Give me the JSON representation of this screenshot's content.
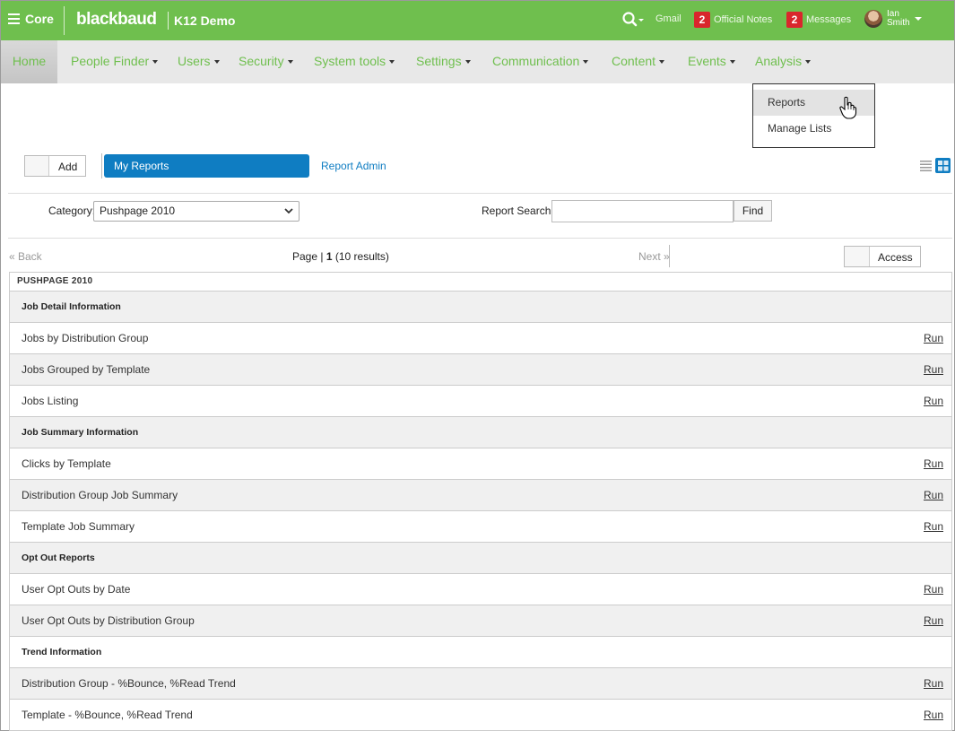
{
  "topbar": {
    "menu_label": "Core",
    "brand": "blackbaud",
    "brand_sub": "K12 Demo",
    "gmail": "Gmail",
    "official_notes": {
      "count": "2",
      "label": "Official Notes"
    },
    "messages": {
      "count": "2",
      "label": "Messages"
    },
    "user": {
      "first": "Ian",
      "last": "Smith"
    },
    "colors": {
      "bar": "#6fbf4e",
      "badge": "#d9262c"
    }
  },
  "nav": {
    "home": "Home",
    "items": [
      "People Finder",
      "Users",
      "Security",
      "System tools",
      "Settings",
      "Communication",
      "Content",
      "Events",
      "Analysis"
    ]
  },
  "analysis_menu": {
    "items": [
      "Reports",
      "Manage Lists"
    ]
  },
  "toolbar": {
    "add_label": "Add",
    "my_reports_tab": "My Reports",
    "report_admin": "Report Admin",
    "accent": "#0f7dc2"
  },
  "filters": {
    "category_label": "Category:",
    "category_value": "Pushpage 2010",
    "search_label": "Report Search:",
    "search_value": "",
    "find_label": "Find"
  },
  "pager": {
    "back": "« Back",
    "page_prefix": "Page |",
    "page_num": "1",
    "results": "(10 results)",
    "next": "Next »",
    "access_label": "Access"
  },
  "table": {
    "heading": "PUSHPAGE 2010",
    "run_label": "Run",
    "groups": [
      {
        "title": "Job Detail Information",
        "items": [
          "Jobs by Distribution Group",
          "Jobs Grouped by Template",
          "Jobs Listing"
        ]
      },
      {
        "title": "Job Summary Information",
        "items": [
          "Clicks by Template",
          "Distribution Group Job Summary",
          "Template Job Summary"
        ]
      },
      {
        "title": "Opt Out Reports",
        "items": [
          "User Opt Outs by Date",
          "User Opt Outs by Distribution Group"
        ]
      },
      {
        "title": "Trend Information",
        "items": [
          "Distribution Group - %Bounce, %Read Trend",
          "Template - %Bounce, %Read Trend"
        ]
      }
    ]
  }
}
